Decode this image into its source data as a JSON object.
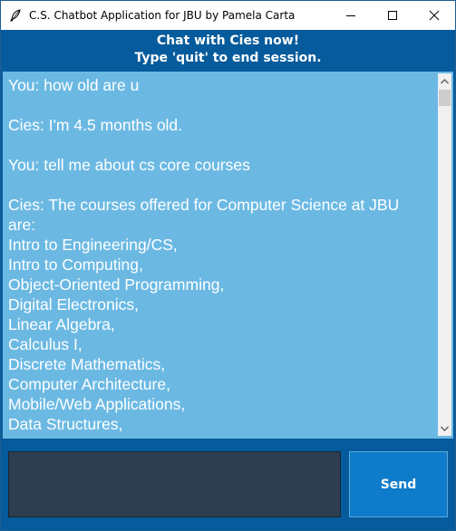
{
  "window": {
    "title": "C.S. Chatbot Application for JBU by Pamela Carta",
    "icon": "feather-icon",
    "controls": [
      "minimize-icon",
      "maximize-icon",
      "close-icon"
    ]
  },
  "header": {
    "line1": "Chat with Cies now!",
    "line2": "Type 'quit' to end session."
  },
  "chat": {
    "lines": [
      "You: how old are u",
      "",
      "Cies: I'm 4.5 months old.",
      "",
      "You: tell me about cs core courses",
      "",
      "Cies: The courses offered for Computer Science at JBU",
      "are:",
      "Intro to Engineering/CS,",
      "Intro to Computing,",
      "Object-Oriented Programming,",
      "Digital Electronics,",
      "Linear Algebra,",
      "Calculus I,",
      "Discrete Mathematics,",
      "Computer Architecture,",
      "Mobile/Web Applications,",
      "Data Structures,"
    ]
  },
  "input": {
    "value": "",
    "placeholder": ""
  },
  "send_label": "Send",
  "colors": {
    "frame": "#055b9b",
    "chat_bg": "#6bb9e3",
    "input_bg": "#2c3e50",
    "send_bg": "#0f7bcb",
    "text": "#ffffff"
  }
}
